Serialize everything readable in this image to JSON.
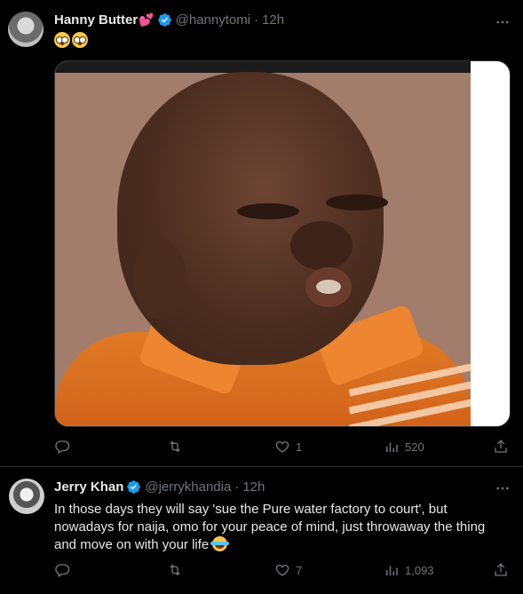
{
  "tweets": [
    {
      "author": {
        "name": "Hanny Butter",
        "name_emoji": "💕",
        "handle": "@hannytomi",
        "time": "12h",
        "verified": true
      },
      "text": "",
      "emojis": [
        "flushed-face",
        "flushed-face"
      ],
      "media": {
        "type": "image",
        "alt": ""
      },
      "stats": {
        "replies": "",
        "retweets": "",
        "likes": "1",
        "views": "520"
      }
    },
    {
      "author": {
        "name": "Jerry Khan",
        "handle": "@jerrykhandia",
        "time": "12h",
        "verified": true
      },
      "text": "In those days they will say 'sue the Pure water factory to court', but nowadays for naija, omo for your peace of mind, just throwaway the thing and move on with your life",
      "trailing_emoji": "face-with-tears-of-joy",
      "stats": {
        "replies": "",
        "retweets": "",
        "likes": "7",
        "views": "1,093"
      }
    }
  ],
  "icons": {
    "reply": "reply-icon",
    "retweet": "retweet-icon",
    "like": "heart-icon",
    "views": "views-icon",
    "share": "share-icon",
    "more": "more-icon",
    "verified": "verified-badge-icon"
  },
  "colors": {
    "background": "#000000",
    "text": "#e7e9ea",
    "muted": "#71767b",
    "verified": "#1d9bf0",
    "divider": "#2f3336"
  }
}
